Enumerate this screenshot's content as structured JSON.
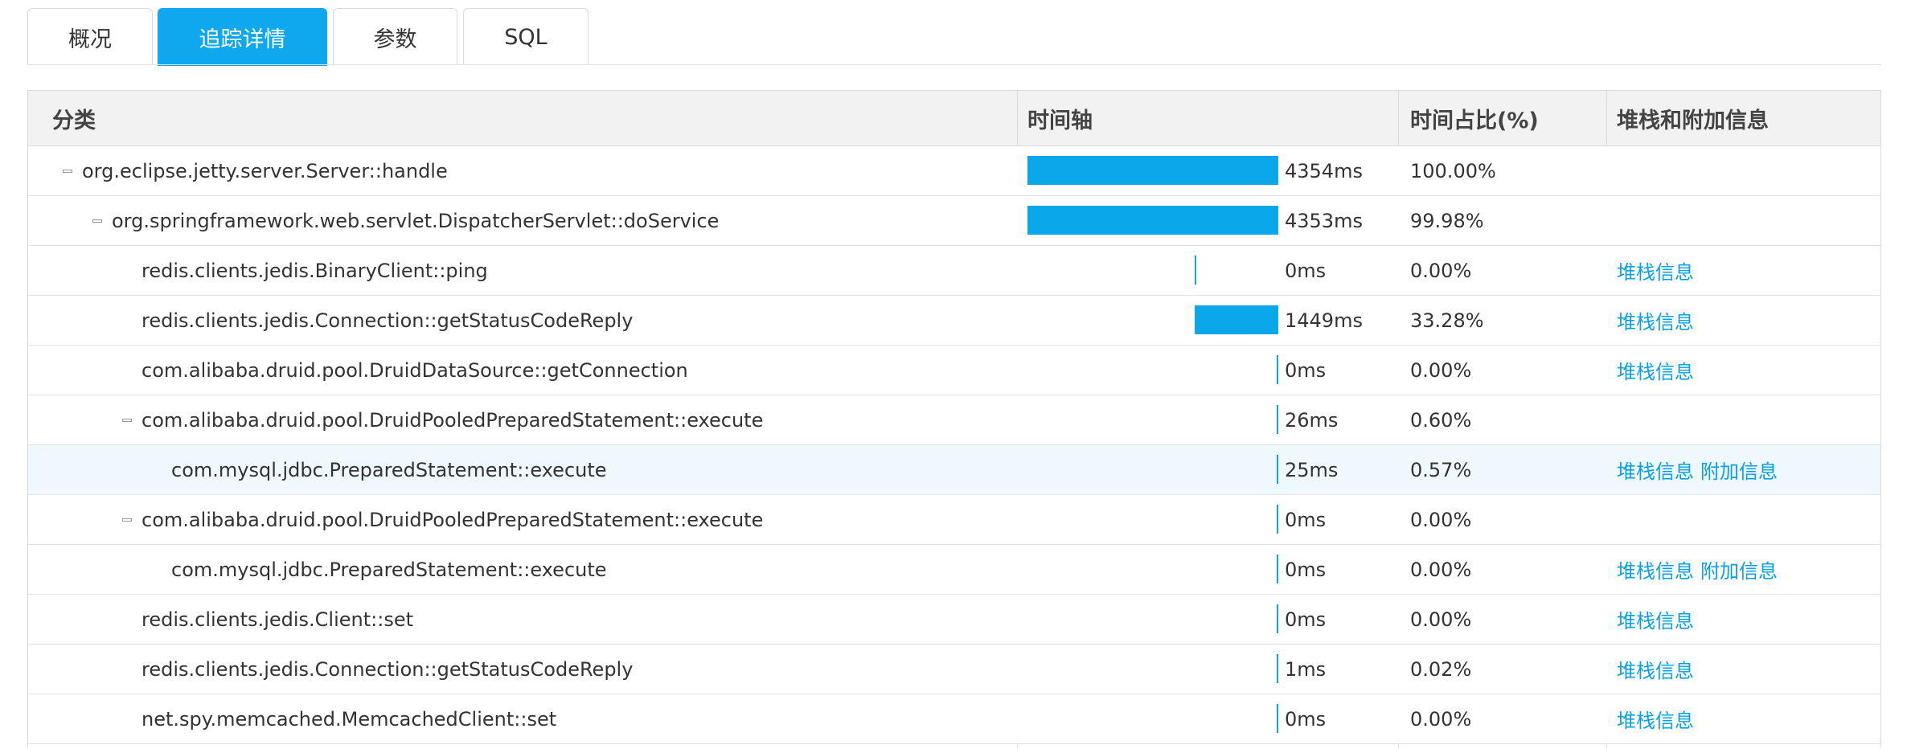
{
  "tabs": [
    {
      "label": "概况",
      "active": false
    },
    {
      "label": "追踪详情",
      "active": true
    },
    {
      "label": "参数",
      "active": false
    },
    {
      "label": "SQL",
      "active": false
    }
  ],
  "table": {
    "headers": {
      "category": "分类",
      "timeline": "时间轴",
      "percent": "时间占比(%)",
      "stack": "堆栈和附加信息"
    },
    "accent_color": "#0aa8ea",
    "rows": [
      {
        "method": "org.eclipse.jetty.server.Server::handle",
        "depth": 0,
        "collapsible": true,
        "time": "4354ms",
        "percent": "100.00%",
        "links": []
      },
      {
        "method": "org.springframework.web.servlet.DispatcherServlet::doService",
        "depth": 1,
        "collapsible": true,
        "time": "4353ms",
        "percent": "99.98%",
        "links": []
      },
      {
        "method": "redis.clients.jedis.BinaryClient::ping",
        "depth": 2,
        "collapsible": false,
        "time": "0ms",
        "percent": "0.00%",
        "links": [
          "堆栈信息"
        ]
      },
      {
        "method": "redis.clients.jedis.Connection::getStatusCodeReply",
        "depth": 2,
        "collapsible": false,
        "time": "1449ms",
        "percent": "33.28%",
        "links": [
          "堆栈信息"
        ]
      },
      {
        "method": "com.alibaba.druid.pool.DruidDataSource::getConnection",
        "depth": 2,
        "collapsible": false,
        "time": "0ms",
        "percent": "0.00%",
        "links": [
          "堆栈信息"
        ]
      },
      {
        "method": "com.alibaba.druid.pool.DruidPooledPreparedStatement::execute",
        "depth": 2,
        "collapsible": true,
        "time": "26ms",
        "percent": "0.60%",
        "links": []
      },
      {
        "method": "com.mysql.jdbc.PreparedStatement::execute",
        "depth": 3,
        "collapsible": false,
        "time": "25ms",
        "percent": "0.57%",
        "links": [
          "堆栈信息",
          "附加信息"
        ],
        "highlighted": true
      },
      {
        "method": "com.alibaba.druid.pool.DruidPooledPreparedStatement::execute",
        "depth": 2,
        "collapsible": true,
        "time": "0ms",
        "percent": "0.00%",
        "links": []
      },
      {
        "method": "com.mysql.jdbc.PreparedStatement::execute",
        "depth": 3,
        "collapsible": false,
        "time": "0ms",
        "percent": "0.00%",
        "links": [
          "堆栈信息",
          "附加信息"
        ]
      },
      {
        "method": "redis.clients.jedis.Client::set",
        "depth": 2,
        "collapsible": false,
        "time": "0ms",
        "percent": "0.00%",
        "links": [
          "堆栈信息"
        ]
      },
      {
        "method": "redis.clients.jedis.Connection::getStatusCodeReply",
        "depth": 2,
        "collapsible": false,
        "time": "1ms",
        "percent": "0.02%",
        "links": [
          "堆栈信息"
        ]
      },
      {
        "method": "net.spy.memcached.MemcachedClient::set",
        "depth": 2,
        "collapsible": false,
        "time": "0ms",
        "percent": "0.00%",
        "links": [
          "堆栈信息"
        ]
      }
    ]
  }
}
